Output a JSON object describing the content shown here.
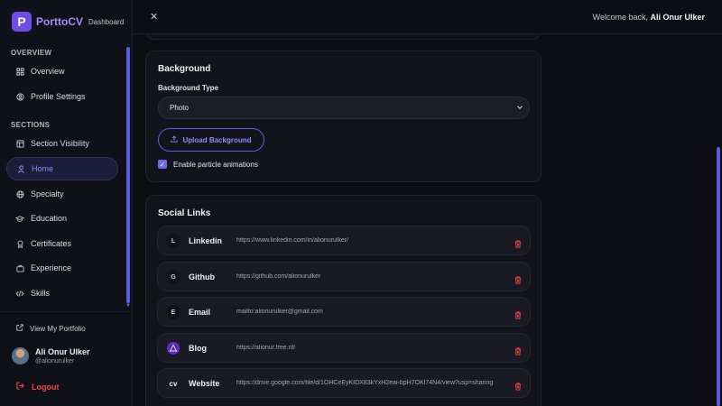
{
  "brand": {
    "logo_letter": "P",
    "name": "PorttoCV",
    "subtitle": "Dashboard"
  },
  "sidebar": {
    "sections": [
      {
        "title": "OVERVIEW"
      },
      {
        "title": "SECTIONS"
      }
    ],
    "items": [
      {
        "label": "Overview",
        "icon": "grid-icon"
      },
      {
        "label": "Profile Settings",
        "icon": "user-circle-icon"
      },
      {
        "label": "Section Visibility",
        "icon": "layout-icon"
      },
      {
        "label": "Home",
        "icon": "user-icon",
        "active": true
      },
      {
        "label": "Specialty",
        "icon": "globe-icon"
      },
      {
        "label": "Education",
        "icon": "graduation-cap-icon"
      },
      {
        "label": "Certificates",
        "icon": "award-icon"
      },
      {
        "label": "Experience",
        "icon": "briefcase-icon"
      },
      {
        "label": "Skills",
        "icon": "code-icon"
      }
    ],
    "view_portfolio": "View My Portfolio",
    "user": {
      "name": "Ali Onur Ulker",
      "handle": "@alionurulker"
    },
    "logout": "Logout"
  },
  "header": {
    "close_label": "✕",
    "welcome_prefix": "Welcome back,",
    "welcome_name": "Ali Onur Ulker"
  },
  "background": {
    "title": "Background",
    "type_label": "Background Type",
    "type_value": "Photo",
    "upload_label": "Upload Background",
    "particles_label": "Enable particle animations",
    "particles_checked": true
  },
  "social": {
    "title": "Social Links",
    "links": [
      {
        "initial": "L",
        "name": "Linkedin",
        "url": "https://www.linkedin.com/in/alionurulker/"
      },
      {
        "initial": "G",
        "name": "Github",
        "url": "https://github.com/alionurulker"
      },
      {
        "initial": "E",
        "name": "Email",
        "url": "mailto:alionurulker@gmail.com"
      },
      {
        "initial": "",
        "name": "Blog",
        "url": "https://alionur.free.nf/"
      },
      {
        "initial": "cv",
        "name": "Website",
        "url": "https://drive.google.com/file/d/1OHCeEyKIDX83kYxH2eai-bpH7OKl74N4/view?usp=sharing"
      }
    ]
  },
  "colors": {
    "accent": "#6b6ce8",
    "danger": "#ef4444",
    "background": "#0d0d14",
    "card": "#13131c"
  }
}
